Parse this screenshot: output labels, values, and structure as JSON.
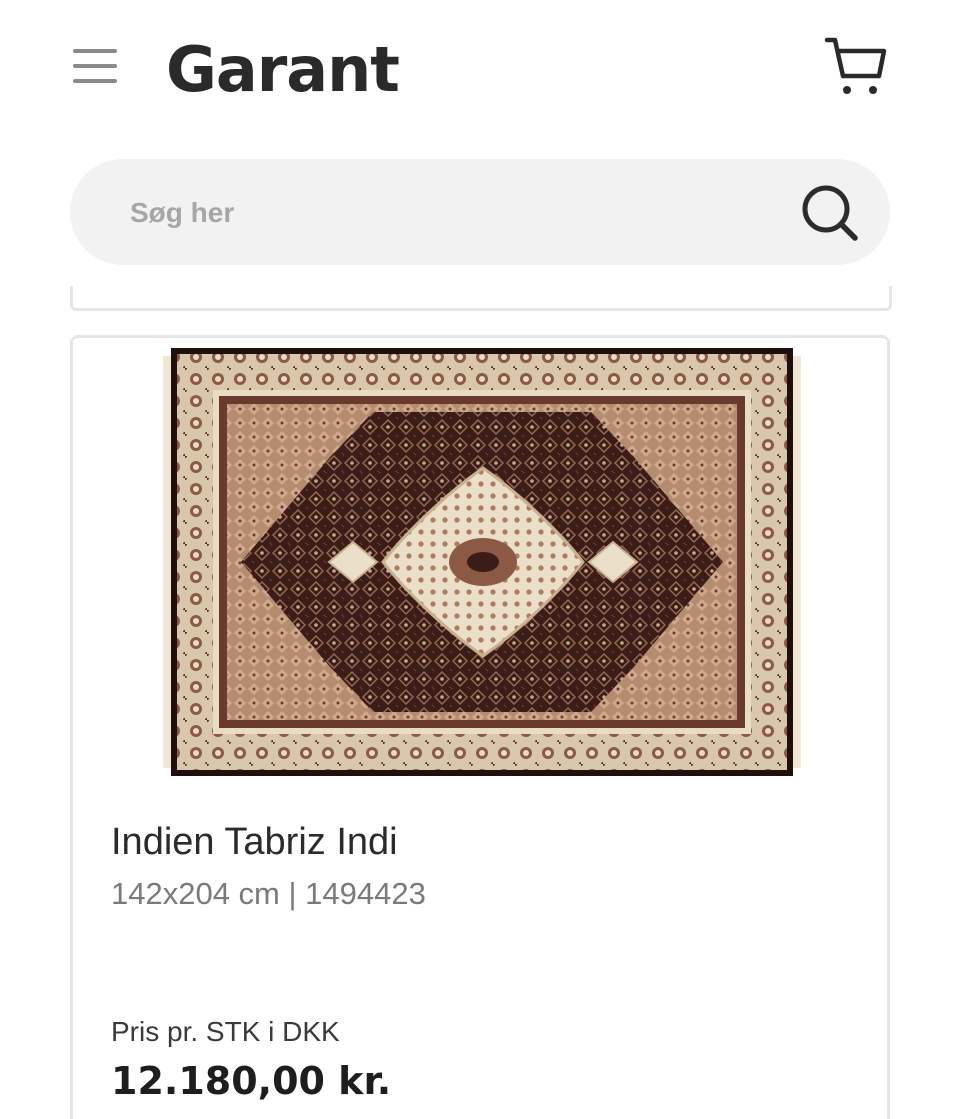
{
  "header": {
    "menu_icon": "hamburger-menu-icon",
    "logo_text": "Garant",
    "cart_icon": "shopping-cart-icon"
  },
  "search": {
    "placeholder": "Søg her",
    "value": "",
    "icon": "search-icon"
  },
  "product": {
    "image_alt": "Indien Tabriz Indi rug",
    "title": "Indien Tabriz Indi",
    "meta": "142x204 cm | 1494423",
    "price_label": "Pris pr. STK i DKK",
    "price": "12.180,00 kr."
  },
  "colors": {
    "background": "#ffffff",
    "search_bg": "#f2f2f2",
    "card_border": "#e6e6e6",
    "text_dark": "#2b2b2b",
    "text_muted": "#7a7a7a",
    "rug_dark": "#3a1d18",
    "rug_light": "#e8dcc4",
    "rug_accent": "#8c5a44"
  }
}
